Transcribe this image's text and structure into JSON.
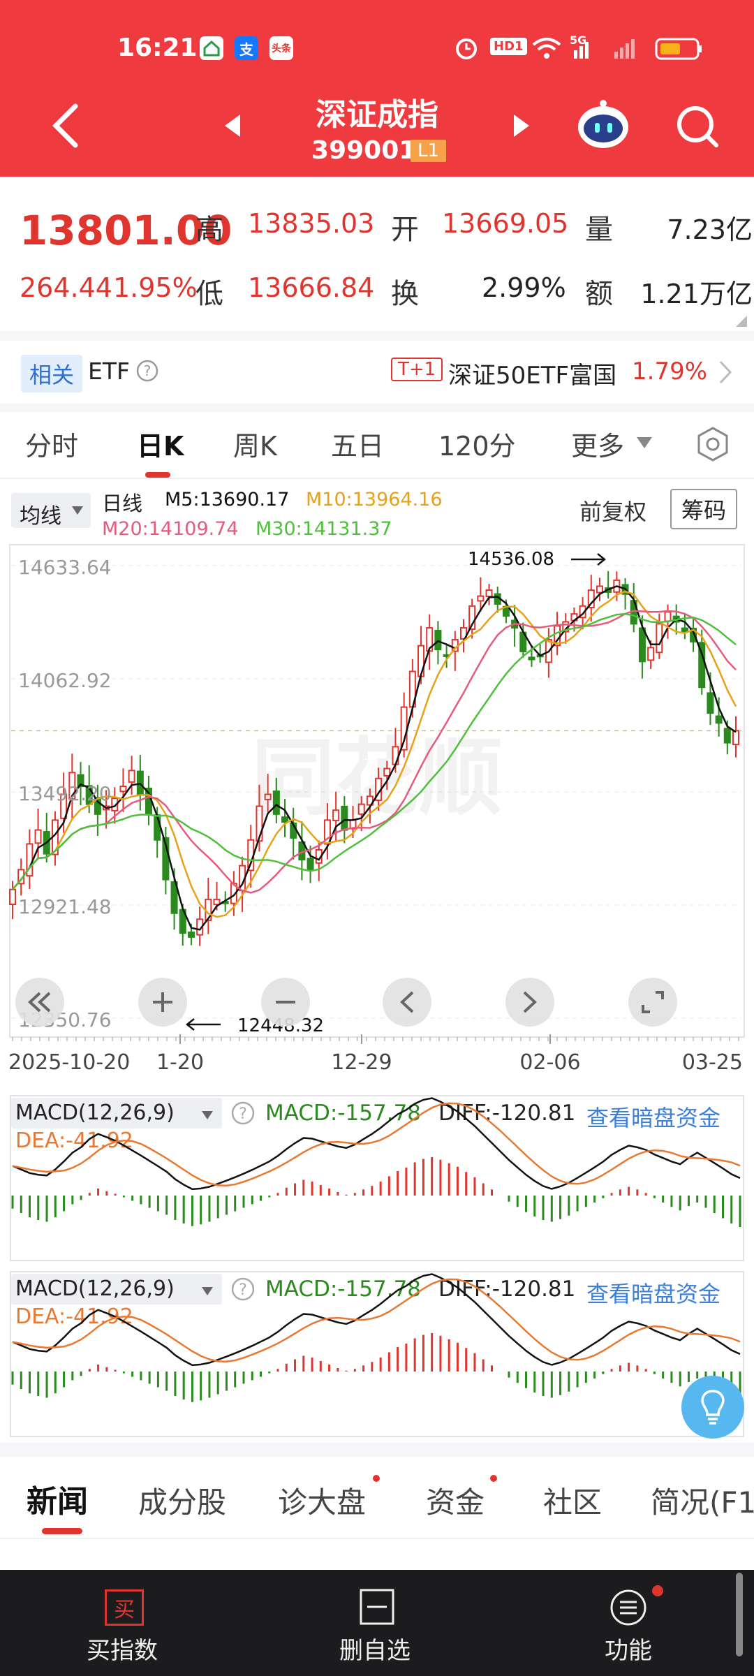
{
  "status_bar": {
    "time": "16:21",
    "notif_icons": [
      "app-icon",
      "alipay-icon",
      "toutiao-icon"
    ],
    "alipay_glyph": "支",
    "toutiao_glyph": "头条",
    "hd_label": "HD1",
    "signal_label": "5G"
  },
  "header": {
    "title": "深证成指",
    "code": "399001",
    "level": "L1"
  },
  "quote": {
    "price": "13801.00",
    "change": "264.44",
    "change_pct": "1.95%",
    "high_label": "高",
    "high": "13835.03",
    "open_label": "开",
    "open": "13669.05",
    "vol_label": "量",
    "vol": "7.23亿",
    "low_label": "低",
    "low": "13666.84",
    "turn_label": "换",
    "turn": "2.99%",
    "amt_label": "额",
    "amt": "1.21万亿"
  },
  "etf": {
    "tag": "相关",
    "label": "ETF",
    "badge": "T+1",
    "name": "深证50ETF富国",
    "pct": "1.79%"
  },
  "tabs": [
    "分时",
    "日K",
    "周K",
    "五日",
    "120分",
    "更多"
  ],
  "active_tab": 1,
  "ma": {
    "selector": "均线",
    "type": "日线",
    "m5": "M5:13690.17",
    "m10": "M10:13964.16",
    "m20": "M20:14109.74",
    "m30": "M30:14131.37",
    "fuquan": "前复权",
    "chouma": "筹码"
  },
  "colors": {
    "header": "#ef3b3f",
    "up": "#e0352e",
    "down": "#2a8a1e",
    "m5": "#111111",
    "m10": "#e6a219",
    "m20": "#e55b7e",
    "m30": "#4fbf3c",
    "macd_link": "#3d7fd6",
    "dea": "#e87933"
  },
  "chart_data": {
    "type": "candlestick",
    "y_labels": [
      "14633.64",
      "14062.92",
      "13492.20",
      "12921.48",
      "12350.76"
    ],
    "ylim": [
      12350.76,
      14633.64
    ],
    "x_labels": [
      "2025-10-20",
      "1-20",
      "12-29",
      "02-06",
      "03-25"
    ],
    "max_label": "14536.08",
    "min_label": "12448.32",
    "trend": [
      13000,
      13100,
      13230,
      13300,
      13180,
      13350,
      13480,
      13590,
      13520,
      13430,
      13380,
      13420,
      13460,
      13520,
      13600,
      13480,
      13380,
      13250,
      13050,
      12880,
      12780,
      12760,
      12850,
      12950,
      12950,
      12930,
      13030,
      13120,
      13250,
      13420,
      13480,
      13380,
      13340,
      13260,
      13150,
      13100,
      13200,
      13350,
      13400,
      13300,
      13350,
      13430,
      13470,
      13560,
      13610,
      13720,
      13920,
      14100,
      14230,
      14320,
      14210,
      14180,
      14260,
      14320,
      14430,
      14480,
      14510,
      14440,
      14380,
      14320,
      14200,
      14160,
      14180,
      14260,
      14330,
      14350,
      14390,
      14430,
      14510,
      14530,
      14500,
      14560,
      14490,
      14340,
      14150,
      14220,
      14340,
      14400,
      14350,
      14300,
      14250,
      14020,
      13890,
      13840,
      13740,
      13801
    ]
  },
  "macd": {
    "label": "MACD(12,26,9)",
    "macd": "MACD:-157.78",
    "diff": "DIFF:-120.81",
    "link": "查看暗盘资金",
    "dea": "DEA:-41.92",
    "hist": [
      -15,
      -20,
      -25,
      -28,
      -30,
      -25,
      -18,
      -10,
      -5,
      3,
      8,
      5,
      2,
      -2,
      -6,
      -10,
      -14,
      -18,
      -22,
      -28,
      -32,
      -35,
      -33,
      -30,
      -26,
      -22,
      -18,
      -14,
      -10,
      -6,
      -2,
      3,
      9,
      14,
      18,
      16,
      12,
      8,
      4,
      1,
      3,
      7,
      11,
      16,
      22,
      28,
      32,
      38,
      42,
      44,
      41,
      37,
      33,
      27,
      21,
      14,
      7,
      0,
      -7,
      -13,
      -19,
      -24,
      -28,
      -30,
      -27,
      -23,
      -18,
      -13,
      -8,
      -3,
      3,
      7,
      10,
      7,
      3,
      -3,
      -8,
      -13,
      -17,
      -12,
      -8,
      -14,
      -20,
      -26,
      -32,
      -36
    ]
  },
  "bottom_tabs": [
    "新闻",
    "成分股",
    "诊大盘",
    "资金",
    "社区",
    "简况(F1"
  ],
  "bottom_nav": [
    {
      "icon": "buy-icon",
      "label": "买指数",
      "glyph": "买"
    },
    {
      "icon": "minus-box-icon",
      "label": "删自选"
    },
    {
      "icon": "menu-circle-icon",
      "label": "功能"
    }
  ]
}
